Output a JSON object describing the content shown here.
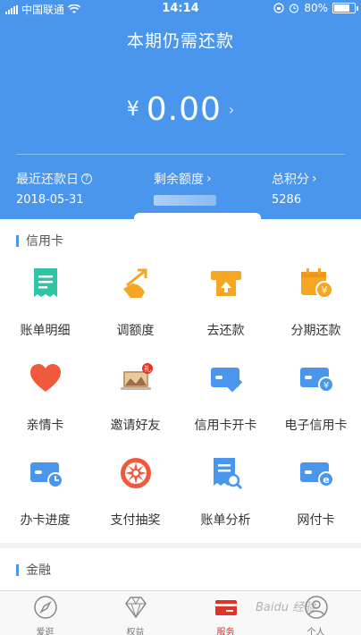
{
  "status_bar": {
    "carrier": "中国联通",
    "time": "14:14",
    "battery": "80%",
    "battery_level": 0.8
  },
  "hero": {
    "title": "本期仍需还款",
    "currency": "¥",
    "amount": "0.00",
    "stats": {
      "last_repay_label": "最近还款日",
      "last_repay_value": "2018-05-31",
      "credit_label": "剩余额度",
      "points_label": "总积分",
      "points_value": "5286"
    }
  },
  "credit_section": {
    "title": "信用卡",
    "items": [
      {
        "label": "账单明细",
        "icon": "bill-detail-icon"
      },
      {
        "label": "调额度",
        "icon": "adjust-limit-icon"
      },
      {
        "label": "去还款",
        "icon": "repay-icon"
      },
      {
        "label": "分期还款",
        "icon": "installment-icon"
      },
      {
        "label": "亲情卡",
        "icon": "heart-icon"
      },
      {
        "label": "邀请好友",
        "icon": "invite-laptop-icon",
        "badge": "礼"
      },
      {
        "label": "信用卡开卡",
        "icon": "card-activate-icon"
      },
      {
        "label": "电子信用卡",
        "icon": "e-card-icon"
      },
      {
        "label": "办卡进度",
        "icon": "card-progress-icon"
      },
      {
        "label": "支付抽奖",
        "icon": "lottery-wheel-icon"
      },
      {
        "label": "账单分析",
        "icon": "bill-analysis-icon"
      },
      {
        "label": "网付卡",
        "icon": "online-pay-card-icon"
      }
    ]
  },
  "finance_section": {
    "title": "金融"
  },
  "tabbar": {
    "tabs": [
      {
        "label": "爱逛",
        "icon": "compass-icon"
      },
      {
        "label": "权益",
        "icon": "diamond-icon"
      },
      {
        "label": "服务",
        "icon": "card-service-icon",
        "active": true
      },
      {
        "label": "个人",
        "icon": "person-icon"
      }
    ]
  },
  "watermark": "Baidu 经验",
  "colors": {
    "primary_blue": "#4a96ec",
    "teal": "#2ec4a4",
    "orange": "#f5a623",
    "red_orange": "#f05a3c",
    "active_red": "#e0332a"
  }
}
